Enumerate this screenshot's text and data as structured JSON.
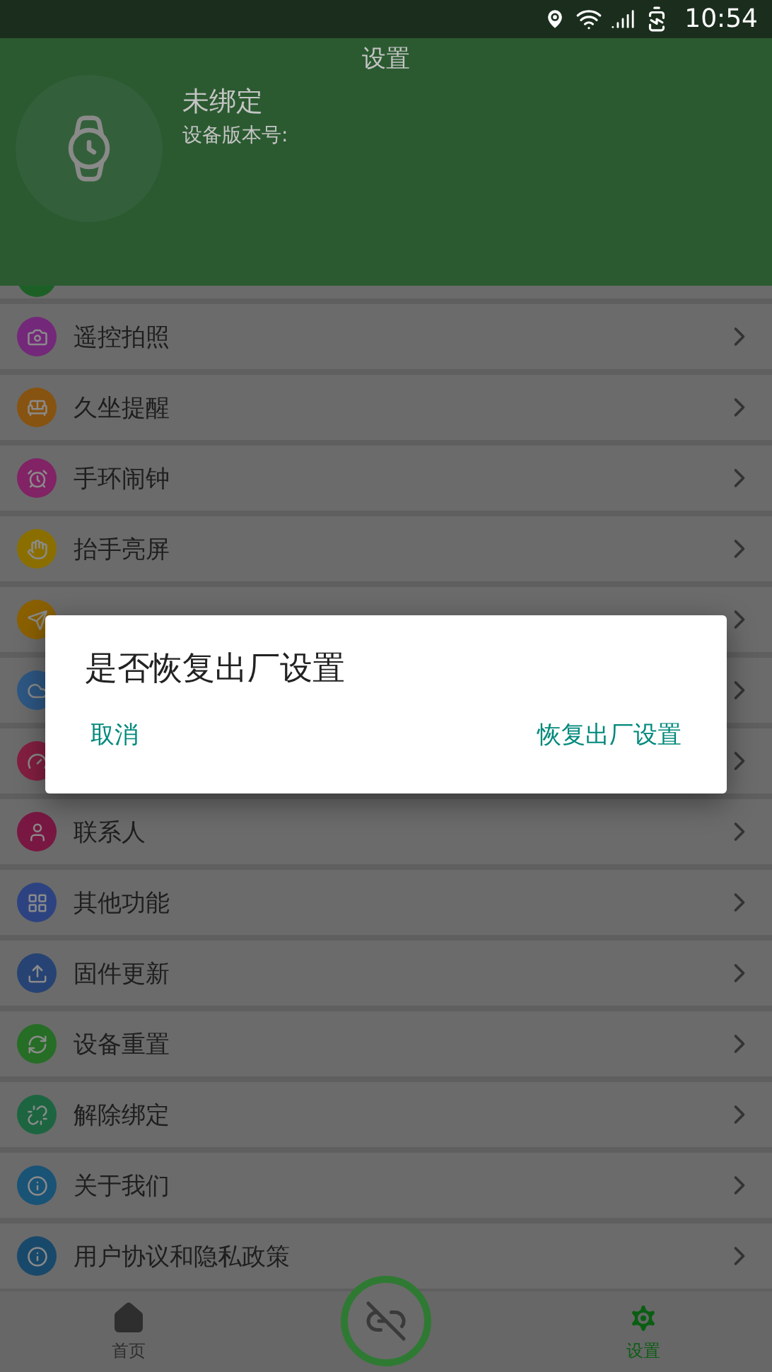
{
  "status_bar": {
    "time": "10:54"
  },
  "header": {
    "title": "设置",
    "device_name": "未绑定",
    "version_label": "设备版本号:"
  },
  "menu": [
    {
      "kind": "partial",
      "color": "#1c6026"
    },
    {
      "label": "遥控拍照",
      "color": "#74287a"
    },
    {
      "label": "久坐提醒",
      "color": "#875310"
    },
    {
      "label": "手环闹钟",
      "color": "#812365"
    },
    {
      "label": "抬手亮屏",
      "color": "#8a6f00"
    },
    {
      "color": "#8a6000"
    },
    {
      "color": "#2d5783"
    },
    {
      "color": "#831f40"
    },
    {
      "label": "联系人",
      "color": "#781842"
    },
    {
      "label": "其他功能",
      "color": "#2d4381"
    },
    {
      "label": "固件更新",
      "color": "#264373"
    },
    {
      "label": "设备重置",
      "color": "#266d26"
    },
    {
      "label": "解除绑定",
      "color": "#1c6540"
    },
    {
      "label": "关于我们",
      "color": "#195376"
    },
    {
      "label": "用户协议和隐私政策",
      "color": "#19496a"
    }
  ],
  "bottom_nav": [
    {
      "label": "首页",
      "selected": false
    },
    {
      "label": "设置",
      "selected": true
    }
  ],
  "dialog": {
    "title": "是否恢复出厂设置",
    "buttons": [
      "取消",
      "恢复出厂设置"
    ]
  }
}
